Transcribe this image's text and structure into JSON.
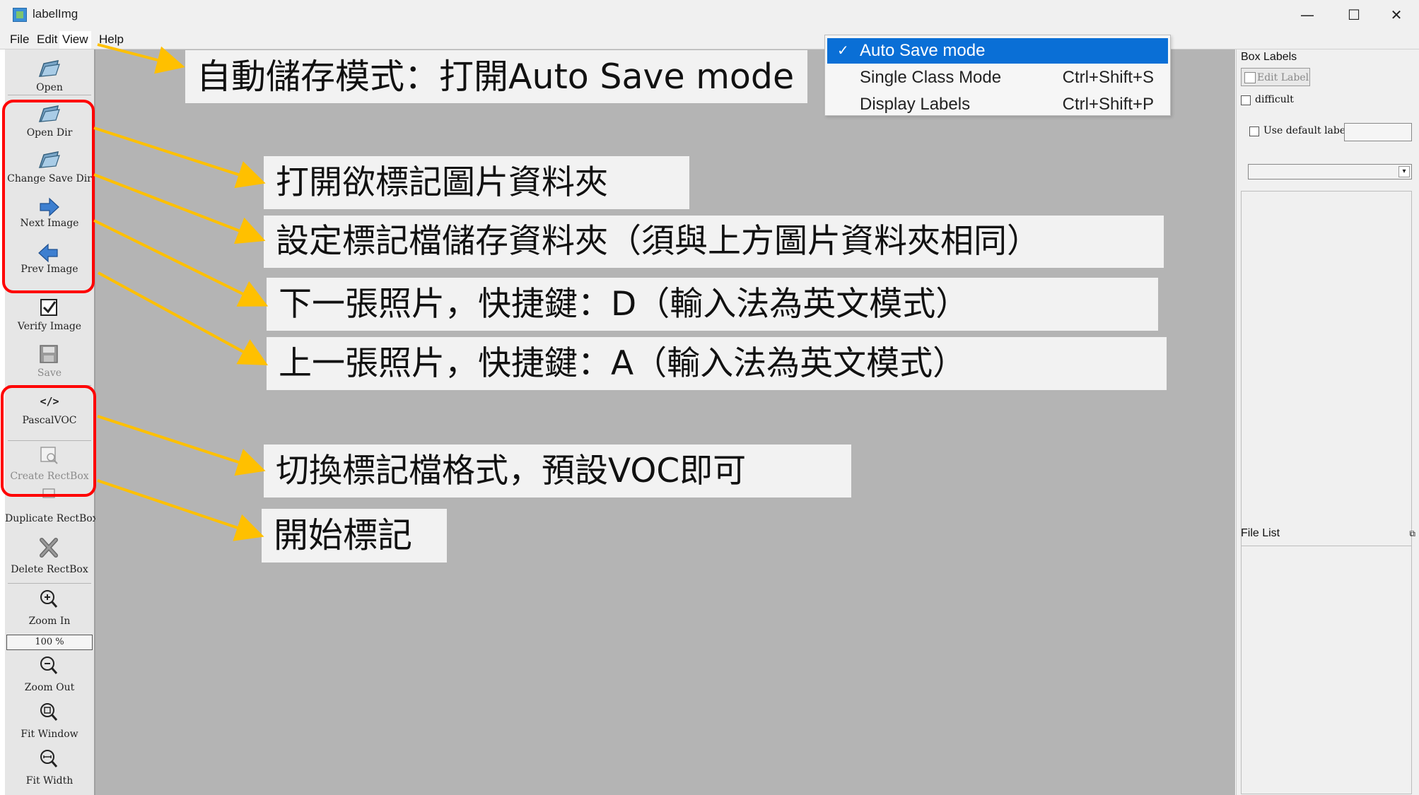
{
  "window": {
    "title": "labelImg",
    "minimize_glyph": "—",
    "maximize_glyph": "☐",
    "close_glyph": "✕"
  },
  "menubar": [
    "File",
    "Edit",
    "View",
    "Help"
  ],
  "view_menu": {
    "items": [
      {
        "label": "Auto Save mode",
        "shortcut": "",
        "checked": true,
        "selected": true
      },
      {
        "label": "Single Class Mode",
        "shortcut": "Ctrl+Shift+S",
        "checked": false,
        "selected": false
      },
      {
        "label": "Display Labels",
        "shortcut": "Ctrl+Shift+P",
        "checked": false,
        "selected": false
      }
    ],
    "check_glyph": "✓"
  },
  "toolbar": {
    "open": "Open",
    "open_dir": "Open Dir",
    "change_save_dir": "Change Save Dir",
    "next_image": "Next Image",
    "prev_image": "Prev Image",
    "verify_image": "Verify Image",
    "save": "Save",
    "format": "PascalVOC",
    "format_glyph": "</>",
    "create_rectbox": "Create RectBox",
    "duplicate_rectbox": "Duplicate RectBox",
    "delete_rectbox": "Delete RectBox",
    "zoom_in": "Zoom In",
    "zoom_value": "100 %",
    "zoom_out": "Zoom Out",
    "fit_window": "Fit Window",
    "fit_width": "Fit Width"
  },
  "dock": {
    "box_labels_title": "Box Labels",
    "edit_label": "Edit Label",
    "difficult": "difficult",
    "use_default_label": "Use default label",
    "combo_arrow": "▾",
    "file_list_title": "File List",
    "float_glyph": "⧉"
  },
  "annotations": {
    "auto_save": "自動儲存模式：打開Auto Save mode",
    "open_dir": "打開欲標記圖片資料夾",
    "save_dir": "設定標記檔儲存資料夾（須與上方圖片資料夾相同）",
    "next_image": "下一張照片，快捷鍵：D（輸入法為英文模式）",
    "prev_image": "上一張照片，快捷鍵：A（輸入法為英文模式）",
    "format": "切換標記檔格式，預設VOC即可",
    "start": "開始標記"
  },
  "colors": {
    "highlight": "#ff0000",
    "arrow": "#ffc000",
    "menu_selection": "#0a6fd6",
    "canvas": "#b4b4b4"
  }
}
